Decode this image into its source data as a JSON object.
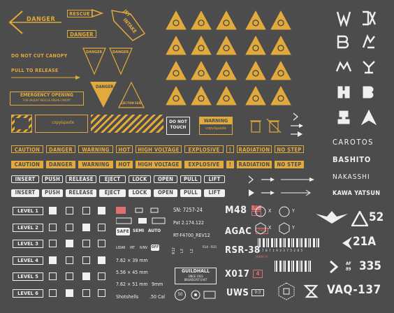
{
  "colors": {
    "background": "#4c4c4c",
    "accent": "#e2a93c",
    "light": "#f0f0f0"
  },
  "top": {
    "danger_arrow": "DANGER",
    "rescue": "RESCUE",
    "danger_box": "DANGER",
    "jet": "JET",
    "intake": "INTAKE",
    "do_not_cut": "DO NOT CUT CANOPY",
    "pull_release": "PULL TO RELEASE",
    "emergency_1": "EMERGENCY OPENING",
    "emergency_2": "FOR URGENT RESCUE BREAK CANOPY",
    "tri_danger_a": "DANGER",
    "tri_danger_b": "DANGER",
    "tri_danger_c": "DANGER",
    "ejection_seat": "EJECTION SEAT",
    "do_not_touch": "DO NOT TOUCH",
    "warning": "WARNING",
    "copy_paste": "copy&paste"
  },
  "yellow_labels": [
    "CAUTION",
    "DANGER",
    "WARNING",
    "HOT",
    "HIGH VOLTAGE",
    "EXPLOSIVE",
    "!",
    "RADIATION",
    "NO STEP"
  ],
  "white_labels": [
    "INSERT",
    "PUSH",
    "RELEASE",
    "EJECT",
    "LOCK",
    "OPEN",
    "PULL",
    "LIFT"
  ],
  "levels": [
    "LEVEL 1",
    "LEVEL 2",
    "LEVEL 3",
    "LEVEL 4",
    "LEVEL 5",
    "LEVEL 6"
  ],
  "mid": {
    "sn": "SN: 7257-24",
    "pat": "Pat 2.174.122",
    "rt": "RT-F4700_REV12",
    "safe": "SAFE",
    "semi": "SEMI",
    "auto": "AUTO",
    "lidar": "LIDAR",
    "irt": "IRT",
    "rnv": "R/NV",
    "off": "OFF",
    "cal1": "7.62 × 39 mm",
    "cal2": "5.56 × 45 mm",
    "cal3": "7.62 × 51 mm",
    "nine": "9mm",
    "shot": "Shotshells",
    "fifty": ".50 Cal",
    "guild": "GUILDHALL",
    "since": "SINCE 1933",
    "broad": "BROADCAST EAST",
    "r12": "R12",
    "l3": "L3",
    "l2": "L2",
    "r14": "R14 - R15",
    "fifty_circle": "50"
  },
  "codes": {
    "m48": "M48",
    "dt": "DT",
    "se": "SE",
    "agac": "AGAC",
    "pu04": "PU04",
    "rsr": "RSR-38",
    "mark": "MARK IV",
    "barcode_num": "3 7 0 7 1 9 3 3 7 5 2 8 5",
    "x017": "X017",
    "fx4": "4",
    "uws": "UWS",
    "ratio": "0:3",
    "vaq": "VAQ-137",
    "n52": "52",
    "n21a": "21A",
    "af": "AF",
    "b9": "89",
    "n335": "335",
    "ox": "X",
    "oy": "Y"
  },
  "brands": {
    "carotos": "CAROTOS",
    "bashito": "BASHITO",
    "nakasshi": "NAKASSHI",
    "kawa": "KAWA YATSUN",
    "cb": "CB",
    "dx": "DX"
  },
  "icons": [
    "arrow-right-icon",
    "warning-triangle-icon",
    "biohazard-icon",
    "radiation-icon",
    "skull-icon",
    "fire-icon",
    "electric-icon"
  ]
}
